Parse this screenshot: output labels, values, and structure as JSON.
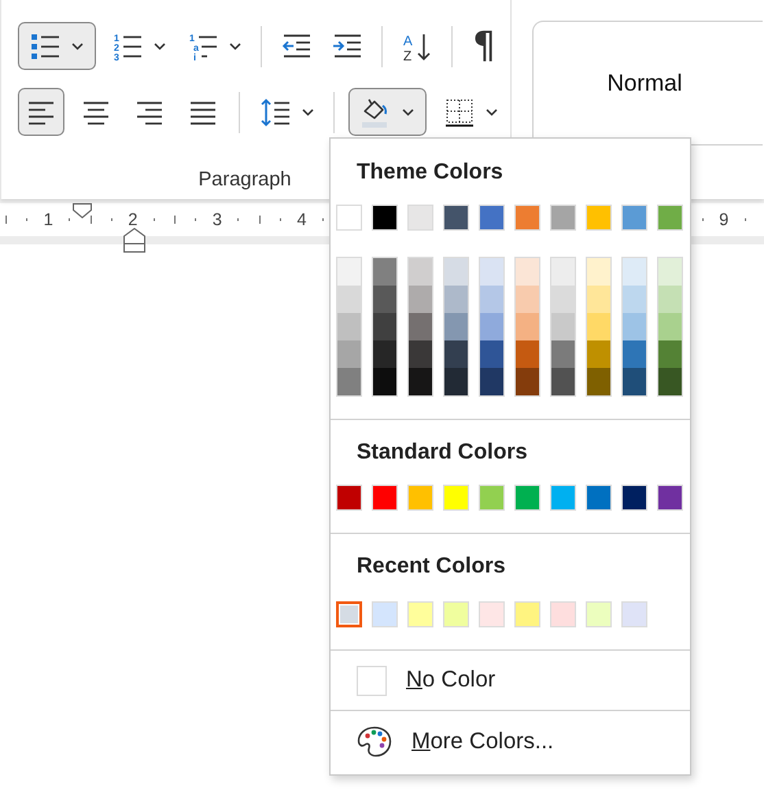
{
  "ribbon": {
    "group_label": "Paragraph",
    "rows": [
      [
        {
          "kind": "bullets",
          "selected": true,
          "dropdown": true
        },
        {
          "kind": "numbering",
          "marks": [
            "1",
            "2",
            "3"
          ],
          "selected": false,
          "dropdown": true
        },
        {
          "kind": "multilevel",
          "marks": [
            "1",
            "a",
            "i"
          ],
          "selected": false,
          "dropdown": true
        },
        {
          "kind": "separator"
        },
        {
          "kind": "decrease_indent",
          "selected": false
        },
        {
          "kind": "increase_indent",
          "selected": false
        },
        {
          "kind": "separator"
        },
        {
          "kind": "sort",
          "marks": [
            "A",
            "Z"
          ],
          "selected": false
        },
        {
          "kind": "separator"
        },
        {
          "kind": "pilcrow",
          "label": "¶",
          "selected": false
        }
      ],
      [
        {
          "kind": "align_left",
          "selected": true
        },
        {
          "kind": "align_center",
          "selected": false
        },
        {
          "kind": "align_right",
          "selected": false
        },
        {
          "kind": "justify",
          "selected": false
        },
        {
          "kind": "separator"
        },
        {
          "kind": "line_spacing",
          "selected": false,
          "dropdown": true
        },
        {
          "kind": "separator"
        },
        {
          "kind": "shading",
          "selected": true,
          "dropdown": true
        },
        {
          "kind": "borders",
          "selected": false,
          "dropdown": true
        }
      ]
    ]
  },
  "style_gallery": {
    "items": [
      {
        "label": "Normal"
      }
    ]
  },
  "ruler": {
    "numbers": [
      "1",
      "2",
      "3",
      "4",
      "9"
    ]
  },
  "shading_menu": {
    "sections": [
      {
        "kind": "theme",
        "title": "Theme Colors",
        "colors": [
          {
            "color": "#ffffff",
            "selected": false
          },
          {
            "color": "#000000",
            "selected": false
          },
          {
            "color": "#e7e6e6",
            "selected": false
          },
          {
            "color": "#44546a",
            "selected": false
          },
          {
            "color": "#4472c4",
            "selected": false
          },
          {
            "color": "#ed7d31",
            "selected": false
          },
          {
            "color": "#a5a5a5",
            "selected": false
          },
          {
            "color": "#ffc000",
            "selected": false
          },
          {
            "color": "#5b9bd5",
            "selected": false
          },
          {
            "color": "#70ad47",
            "selected": false
          }
        ],
        "shades": [
          [
            {
              "color": "#f2f2f2",
              "selected": false
            },
            {
              "color": "#d9d9d9",
              "selected": false
            },
            {
              "color": "#bfbfbf",
              "selected": false
            },
            {
              "color": "#a6a6a6",
              "selected": false
            },
            {
              "color": "#808080",
              "selected": false
            }
          ],
          [
            {
              "color": "#808080",
              "selected": false
            },
            {
              "color": "#595959",
              "selected": false
            },
            {
              "color": "#404040",
              "selected": false
            },
            {
              "color": "#262626",
              "selected": false
            },
            {
              "color": "#0d0d0d",
              "selected": false
            }
          ],
          [
            {
              "color": "#d0cece",
              "selected": false
            },
            {
              "color": "#aeabab",
              "selected": false
            },
            {
              "color": "#757070",
              "selected": false
            },
            {
              "color": "#3a3838",
              "selected": false
            },
            {
              "color": "#171616",
              "selected": false
            }
          ],
          [
            {
              "color": "#d6dce5",
              "selected": false
            },
            {
              "color": "#adb9ca",
              "selected": false
            },
            {
              "color": "#8497b0",
              "selected": false
            },
            {
              "color": "#333f50",
              "selected": false
            },
            {
              "color": "#222a35",
              "selected": false
            }
          ],
          [
            {
              "color": "#dae3f3",
              "selected": false
            },
            {
              "color": "#b4c7e7",
              "selected": false
            },
            {
              "color": "#8faadc",
              "selected": false
            },
            {
              "color": "#2f5597",
              "selected": false
            },
            {
              "color": "#203864",
              "selected": false
            }
          ],
          [
            {
              "color": "#fbe5d6",
              "selected": false
            },
            {
              "color": "#f8cbad",
              "selected": false
            },
            {
              "color": "#f4b183",
              "selected": false
            },
            {
              "color": "#c55a11",
              "selected": false
            },
            {
              "color": "#843c0c",
              "selected": false
            }
          ],
          [
            {
              "color": "#ededed",
              "selected": false
            },
            {
              "color": "#dbdbdb",
              "selected": false
            },
            {
              "color": "#c9c9c9",
              "selected": false
            },
            {
              "color": "#7b7b7b",
              "selected": false
            },
            {
              "color": "#525252",
              "selected": false
            }
          ],
          [
            {
              "color": "#fff2cc",
              "selected": false
            },
            {
              "color": "#ffe699",
              "selected": false
            },
            {
              "color": "#ffd966",
              "selected": false
            },
            {
              "color": "#bf9000",
              "selected": false
            },
            {
              "color": "#7f6000",
              "selected": false
            }
          ],
          [
            {
              "color": "#deebf7",
              "selected": false
            },
            {
              "color": "#bdd7ee",
              "selected": false
            },
            {
              "color": "#9dc3e6",
              "selected": false
            },
            {
              "color": "#2e75b6",
              "selected": false
            },
            {
              "color": "#1f4e79",
              "selected": false
            }
          ],
          [
            {
              "color": "#e2f0d9",
              "selected": false
            },
            {
              "color": "#c5e0b4",
              "selected": false
            },
            {
              "color": "#a9d18e",
              "selected": false
            },
            {
              "color": "#548235",
              "selected": false
            },
            {
              "color": "#385723",
              "selected": false
            }
          ]
        ]
      },
      {
        "kind": "standard",
        "title": "Standard Colors",
        "colors": [
          {
            "color": "#c00000",
            "selected": false
          },
          {
            "color": "#ff0000",
            "selected": false
          },
          {
            "color": "#ffc000",
            "selected": false
          },
          {
            "color": "#ffff00",
            "selected": false
          },
          {
            "color": "#92d050",
            "selected": false
          },
          {
            "color": "#00b050",
            "selected": false
          },
          {
            "color": "#00b0f0",
            "selected": false
          },
          {
            "color": "#0070c0",
            "selected": false
          },
          {
            "color": "#002060",
            "selected": false
          },
          {
            "color": "#7030a0",
            "selected": false
          }
        ]
      },
      {
        "kind": "recent",
        "title": "Recent Colors",
        "colors": [
          {
            "color": "#d5dce4",
            "selected": true
          },
          {
            "color": "#d4e5fd",
            "selected": false
          },
          {
            "color": "#fffe9b",
            "selected": false
          },
          {
            "color": "#f0fe9e",
            "selected": false
          },
          {
            "color": "#fee6e6",
            "selected": false
          },
          {
            "color": "#fff480",
            "selected": false
          },
          {
            "color": "#fedede",
            "selected": false
          },
          {
            "color": "#ecfebe",
            "selected": false
          },
          {
            "color": "#dfe3f7",
            "selected": false
          }
        ]
      }
    ],
    "actions": [
      {
        "kind": "no_color",
        "label": "No Color"
      },
      {
        "kind": "more_colors",
        "label": "More Colors..."
      }
    ]
  }
}
